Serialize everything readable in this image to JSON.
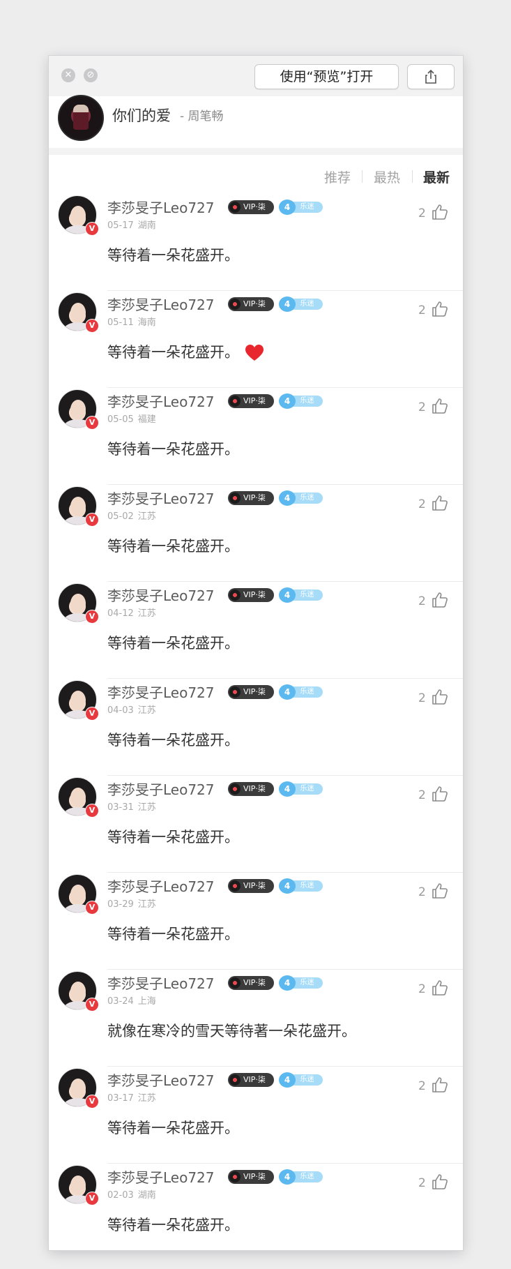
{
  "window": {
    "open_preview_label": "使用“预览”打开"
  },
  "song": {
    "title": "你们的爱",
    "artist": "- 周笔畅"
  },
  "sort_tabs": {
    "recommend": "推荐",
    "hot": "最热",
    "newest": "最新"
  },
  "badges": {
    "vip": "VIP·柒",
    "fan_level": "4",
    "fan_tag": "乐迷",
    "verified": "V"
  },
  "colors": {
    "accent_red": "#e8393f",
    "fan_blue": "#5cb9f0",
    "heart": "#e8262e"
  },
  "comments": [
    {
      "user": "李莎旻子Leo727",
      "date": "05-17",
      "region": "湖南",
      "text": "等待着一朵花盛开。",
      "likes": "2"
    },
    {
      "user": "李莎旻子Leo727",
      "date": "05-11",
      "region": "海南",
      "text": "等待着一朵花盛开。",
      "likes": "2",
      "emoji": "red-heart"
    },
    {
      "user": "李莎旻子Leo727",
      "date": "05-05",
      "region": "福建",
      "text": "等待着一朵花盛开。",
      "likes": "2"
    },
    {
      "user": "李莎旻子Leo727",
      "date": "05-02",
      "region": "江苏",
      "text": "等待着一朵花盛开。",
      "likes": "2"
    },
    {
      "user": "李莎旻子Leo727",
      "date": "04-12",
      "region": "江苏",
      "text": "等待着一朵花盛开。",
      "likes": "2"
    },
    {
      "user": "李莎旻子Leo727",
      "date": "04-03",
      "region": "江苏",
      "text": "等待着一朵花盛开。",
      "likes": "2"
    },
    {
      "user": "李莎旻子Leo727",
      "date": "03-31",
      "region": "江苏",
      "text": "等待着一朵花盛开。",
      "likes": "2"
    },
    {
      "user": "李莎旻子Leo727",
      "date": "03-29",
      "region": "江苏",
      "text": "等待着一朵花盛开。",
      "likes": "2"
    },
    {
      "user": "李莎旻子Leo727",
      "date": "03-24",
      "region": "上海",
      "text": "就像在寒冷的雪天等待著一朵花盛开。",
      "likes": "2"
    },
    {
      "user": "李莎旻子Leo727",
      "date": "03-17",
      "region": "江苏",
      "text": "等待着一朵花盛开。",
      "likes": "2"
    },
    {
      "user": "李莎旻子Leo727",
      "date": "02-03",
      "region": "湖南",
      "text": "等待着一朵花盛开。",
      "likes": "2"
    }
  ]
}
